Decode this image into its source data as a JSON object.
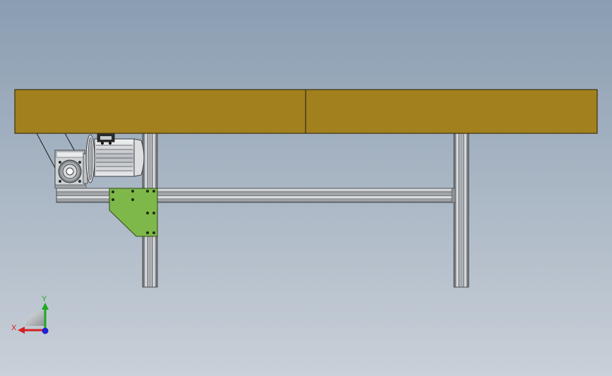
{
  "viewport": {
    "background_top": "#8a9db1",
    "background_bottom": "#c9d0d8"
  },
  "colors": {
    "belt": "#a2801e",
    "belt_edge": "#3c3212",
    "frame_profile": "#c4c8cc",
    "frame_edge": "#4a4e52",
    "bracket_plate": "#7fb84a",
    "motor_body": "#d8dadc",
    "axis_x": "#d42020",
    "axis_y": "#1fa81f",
    "axis_z": "#2020d0"
  },
  "triad": {
    "x_label": "X",
    "y_label": "Y"
  }
}
